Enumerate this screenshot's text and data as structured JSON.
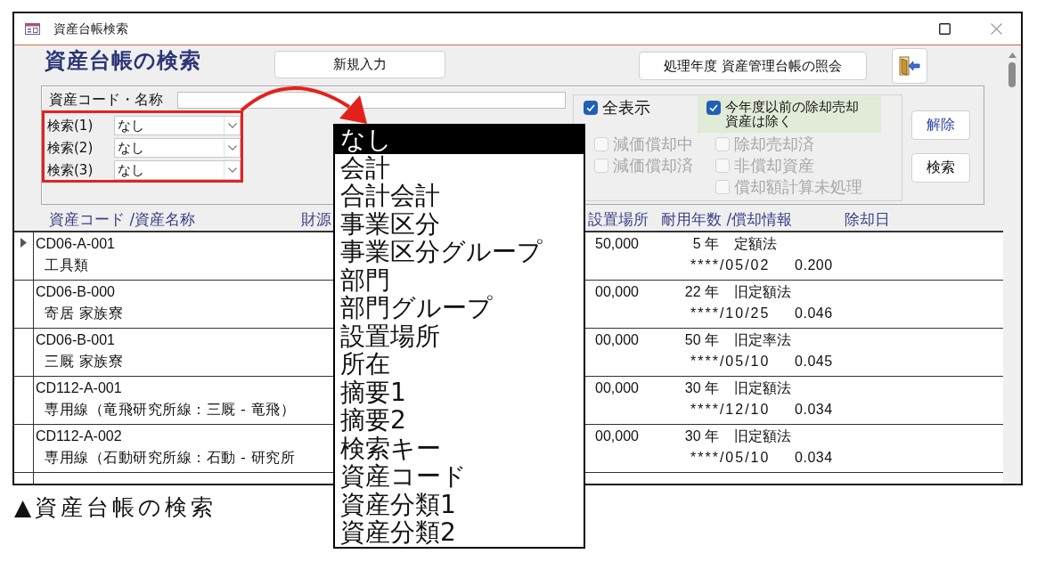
{
  "window": {
    "title": "資産台帳検索"
  },
  "heading": "資産台帳の検索",
  "new_button": "新規入力",
  "inquiry_button": "処理年度 資産管理台帳の照会",
  "search_panel": {
    "code_name_label": "資産コード・名称",
    "search_keys": [
      {
        "label": "検索(1)",
        "value": "なし"
      },
      {
        "label": "検索(2)",
        "value": "なし"
      },
      {
        "label": "検索(3)",
        "value": "なし"
      }
    ],
    "show_all": {
      "label": "全表示",
      "checked": true
    },
    "exclude_retired": {
      "label": "今年度以前の除却売却資産は除く",
      "checked": true
    },
    "status_filter_columns": [
      {
        "items": [
          {
            "label": "減価償却中",
            "checked": false,
            "disabled": true
          },
          {
            "label": "減価償却済",
            "checked": false,
            "disabled": true
          }
        ]
      },
      {
        "items": [
          {
            "label": "除却売却済",
            "checked": false,
            "disabled": true
          },
          {
            "label": "非償却資産",
            "checked": false,
            "disabled": true
          },
          {
            "label": "償却額計算未処理",
            "checked": false,
            "disabled": true
          }
        ]
      }
    ],
    "action_buttons": [
      {
        "label": "解除",
        "kind": "clear"
      },
      {
        "label": "検索",
        "kind": "search"
      }
    ]
  },
  "table": {
    "columns": [
      "資産コード /資産名称",
      "財源",
      "設置場所",
      "耐用年数 /償却情報",
      "除却日"
    ],
    "rows": [
      {
        "current": true,
        "code": "CD06-A-001",
        "name": "工具類",
        "column_3": "50,000",
        "years": "5 年",
        "method": "定額法",
        "date": "****/05/02",
        "rate": "0.200"
      },
      {
        "current": false,
        "code": "CD06-B-000",
        "name": "寄居 家族寮",
        "column_3": "00,000",
        "years": "22 年",
        "method": "旧定額法",
        "date": "****/10/25",
        "rate": "0.046"
      },
      {
        "current": false,
        "code": "CD06-B-001",
        "name": "三厩 家族寮",
        "column_3": "00,000",
        "years": "50 年",
        "method": "旧定率法",
        "date": "****/05/10",
        "rate": "0.045"
      },
      {
        "current": false,
        "code": "CD112-A-001",
        "name": "専用線（竜飛研究所線：三厩 - 竜飛）",
        "column_3": "00,000",
        "years": "30 年",
        "method": "旧定額法",
        "date": "****/12/10",
        "rate": "0.034"
      },
      {
        "current": false,
        "code": "CD112-A-002",
        "name": "専用線（石動研究所線：石動 - 研究所",
        "column_3": "00,000",
        "years": "30 年",
        "method": "旧定額法",
        "date": "****/05/10",
        "rate": "0.034"
      }
    ]
  },
  "dropdown_list": {
    "items": [
      {
        "label": "なし",
        "selected": true
      },
      {
        "label": "会計",
        "selected": false
      },
      {
        "label": "合計会計",
        "selected": false
      },
      {
        "label": "事業区分",
        "selected": false
      },
      {
        "label": "事業区分グループ",
        "selected": false
      },
      {
        "label": "部門",
        "selected": false
      },
      {
        "label": "部門グループ",
        "selected": false
      },
      {
        "label": "設置場所",
        "selected": false
      },
      {
        "label": "所在",
        "selected": false
      },
      {
        "label": "摘要1",
        "selected": false
      },
      {
        "label": "摘要2",
        "selected": false
      },
      {
        "label": "検索キー",
        "selected": false
      },
      {
        "label": "資産コード",
        "selected": false
      },
      {
        "label": "資産分類1",
        "selected": false
      },
      {
        "label": "資産分類2",
        "selected": false
      }
    ]
  },
  "caption": "▲資産台帳の検索"
}
